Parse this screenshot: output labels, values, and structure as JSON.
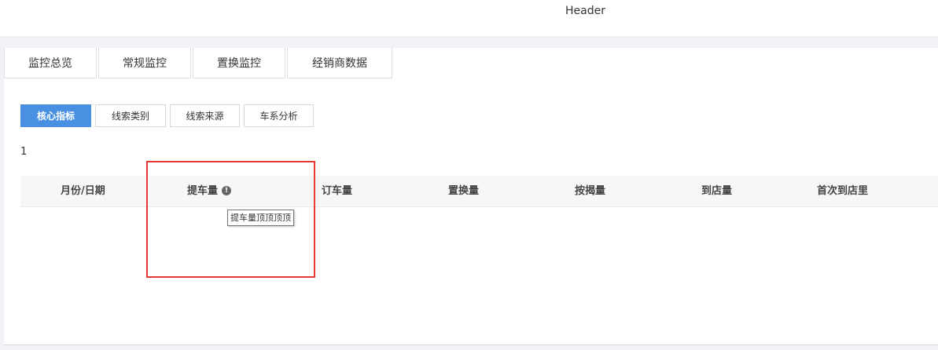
{
  "header": {
    "title": "Header"
  },
  "main_tabs": [
    {
      "label": "监控总览"
    },
    {
      "label": "常规监控"
    },
    {
      "label": "置换监控"
    },
    {
      "label": "经销商数据"
    }
  ],
  "sub_tabs": [
    {
      "label": "核心指标",
      "active": true
    },
    {
      "label": "线索类别",
      "active": false
    },
    {
      "label": "线索来源",
      "active": false
    },
    {
      "label": "车系分析",
      "active": false
    }
  ],
  "count": "1",
  "table": {
    "columns": [
      {
        "label": "月份/日期"
      },
      {
        "label": "提车量",
        "has_info": true
      },
      {
        "label": "订车量"
      },
      {
        "label": "置换量"
      },
      {
        "label": "按揭量"
      },
      {
        "label": "到店量"
      },
      {
        "label": "首次到店里"
      }
    ],
    "info_icon": "info-circle-icon"
  },
  "tooltip": {
    "text": "提车量顶顶顶顶"
  },
  "colors": {
    "accent": "#4a90e2",
    "highlight": "#e53935",
    "header_bg": "#f7f7f7"
  }
}
